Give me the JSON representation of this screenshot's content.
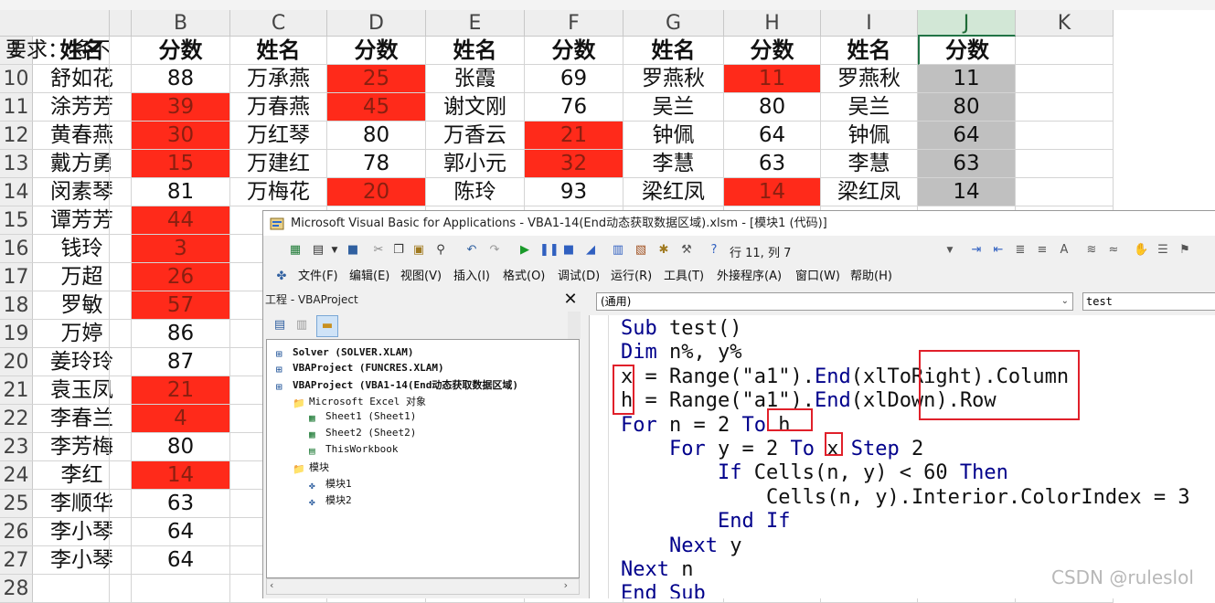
{
  "sheet": {
    "columns": [
      "A",
      "B",
      "C",
      "D",
      "E",
      "F",
      "G",
      "H",
      "I",
      "J",
      "K"
    ],
    "selected_column": "J",
    "rows": [
      {
        "num": "1",
        "cells": [
          "姓名",
          "分数",
          "姓名",
          "分数",
          "姓名",
          "分数",
          "姓名",
          "分数",
          "姓名",
          "分数",
          ""
        ],
        "note": "要求：将不"
      },
      {
        "num": "10",
        "cells": [
          "舒如花",
          "88",
          "万承燕",
          "25",
          "张霞",
          "69",
          "罗燕秋",
          "11",
          "罗燕秋",
          "11",
          ""
        ]
      },
      {
        "num": "11",
        "cells": [
          "涂芳芳",
          "39",
          "万春燕",
          "45",
          "谢文刚",
          "76",
          "吴兰",
          "80",
          "吴兰",
          "80",
          ""
        ]
      },
      {
        "num": "12",
        "cells": [
          "黄春燕",
          "30",
          "万红琴",
          "80",
          "万香云",
          "21",
          "钟佩",
          "64",
          "钟佩",
          "64",
          ""
        ]
      },
      {
        "num": "13",
        "cells": [
          "戴方勇",
          "15",
          "万建红",
          "78",
          "郭小元",
          "32",
          "李慧",
          "63",
          "李慧",
          "63",
          ""
        ]
      },
      {
        "num": "14",
        "cells": [
          "闵素琴",
          "81",
          "万梅花",
          "20",
          "陈玲",
          "93",
          "梁红凤",
          "14",
          "梁红凤",
          "14",
          ""
        ]
      },
      {
        "num": "15",
        "cells": [
          "谭芳芳",
          "44",
          "万",
          "",
          "",
          "",
          "",
          "",
          "",
          "",
          ""
        ]
      },
      {
        "num": "16",
        "cells": [
          "钱玲",
          "3",
          "万",
          "",
          "",
          "",
          "",
          "",
          "",
          "",
          ""
        ]
      },
      {
        "num": "17",
        "cells": [
          "万超",
          "26",
          "",
          "",
          "",
          "",
          "",
          "",
          "",
          "",
          ""
        ]
      },
      {
        "num": "18",
        "cells": [
          "罗敏",
          "57",
          "王",
          "",
          "",
          "",
          "",
          "",
          "",
          "",
          ""
        ]
      },
      {
        "num": "19",
        "cells": [
          "万婷",
          "86",
          "",
          "",
          "",
          "",
          "",
          "",
          "",
          "",
          ""
        ]
      },
      {
        "num": "20",
        "cells": [
          "姜玲玲",
          "87",
          "魏",
          "",
          "",
          "",
          "",
          "",
          "",
          "",
          ""
        ]
      },
      {
        "num": "21",
        "cells": [
          "袁玉凤",
          "21",
          "",
          "",
          "",
          "",
          "",
          "",
          "",
          "",
          ""
        ]
      },
      {
        "num": "22",
        "cells": [
          "李春兰",
          "4",
          "吴",
          "",
          "",
          "",
          "",
          "",
          "",
          "",
          ""
        ]
      },
      {
        "num": "23",
        "cells": [
          "李芳梅",
          "80",
          "吴",
          "",
          "",
          "",
          "",
          "",
          "",
          "",
          ""
        ]
      },
      {
        "num": "24",
        "cells": [
          "李红",
          "14",
          "熊",
          "",
          "",
          "",
          "",
          "",
          "",
          "",
          ""
        ]
      },
      {
        "num": "25",
        "cells": [
          "李顺华",
          "63",
          "喻",
          "",
          "",
          "",
          "",
          "",
          "",
          "",
          ""
        ]
      },
      {
        "num": "26",
        "cells": [
          "李小琴",
          "64",
          "喻",
          "",
          "",
          "",
          "",
          "",
          "",
          "",
          ""
        ]
      },
      {
        "num": "27",
        "cells": [
          "李小琴",
          "64",
          "喻",
          "",
          "",
          "",
          "",
          "",
          "",
          "",
          ""
        ]
      },
      {
        "num": "28",
        "cells": [
          "",
          "",
          "",
          "",
          "",
          "",
          "",
          "",
          "",
          "",
          ""
        ]
      }
    ],
    "red_cells": [
      "10-D",
      "10-H",
      "11-B",
      "11-D",
      "12-B",
      "12-F",
      "13-B",
      "13-F",
      "14-D",
      "14-H",
      "15-B",
      "16-B",
      "17-B",
      "18-B",
      "21-B",
      "22-B",
      "24-B"
    ],
    "gray_cells": [
      "10-J",
      "11-J",
      "12-J",
      "13-J",
      "14-J"
    ],
    "colors": {
      "red": "#ff2a1a",
      "gray": "#c0c0c0",
      "selected_header": "#d2e7d6"
    }
  },
  "vba": {
    "title": "Microsoft Visual Basic for Applications - VBA1-14(End动态获取数据区域).xlsm - [模块1 (代码)]",
    "cursor_pos": "行 11, 列 7",
    "menu": [
      "文件(F)",
      "编辑(E)",
      "视图(V)",
      "插入(I)",
      "格式(O)",
      "调试(D)",
      "运行(R)",
      "工具(T)",
      "外接程序(A)",
      "窗口(W)",
      "帮助(H)"
    ],
    "project": {
      "title": "工程 - VBAProject",
      "tree": [
        {
          "label": "Solver (SOLVER.XLAM)",
          "bold": true
        },
        {
          "label": "VBAProject (FUNCRES.XLAM)",
          "bold": true
        },
        {
          "label": "VBAProject (VBA1-14(End动态获取数据区域)",
          "bold": true
        },
        {
          "label": "Microsoft Excel 对象",
          "bold": false
        },
        {
          "label": "Sheet1 (Sheet1)",
          "bold": false
        },
        {
          "label": "Sheet2 (Sheet2)",
          "bold": false
        },
        {
          "label": "ThisWorkbook",
          "bold": false
        },
        {
          "label": "模块",
          "bold": false
        },
        {
          "label": "模块1",
          "bold": false
        },
        {
          "label": "模块2",
          "bold": false
        }
      ]
    },
    "combo_left": "(通用)",
    "combo_right": "test",
    "code": [
      "Sub test()",
      "Dim n%, y%",
      "x = Range(\"a1\").End(xlToRight).Column",
      "h = Range(\"a1\").End(xlDown).Row",
      "For n = 2 To h",
      "    For y = 2 To x Step 2",
      "        If Cells(n, y) < 60 Then",
      "            Cells(n, y).Interior.ColorIndex = 3",
      "        End If",
      "    Next y",
      "Next n",
      "End Sub"
    ]
  },
  "watermark": "CSDN @ruleslol"
}
